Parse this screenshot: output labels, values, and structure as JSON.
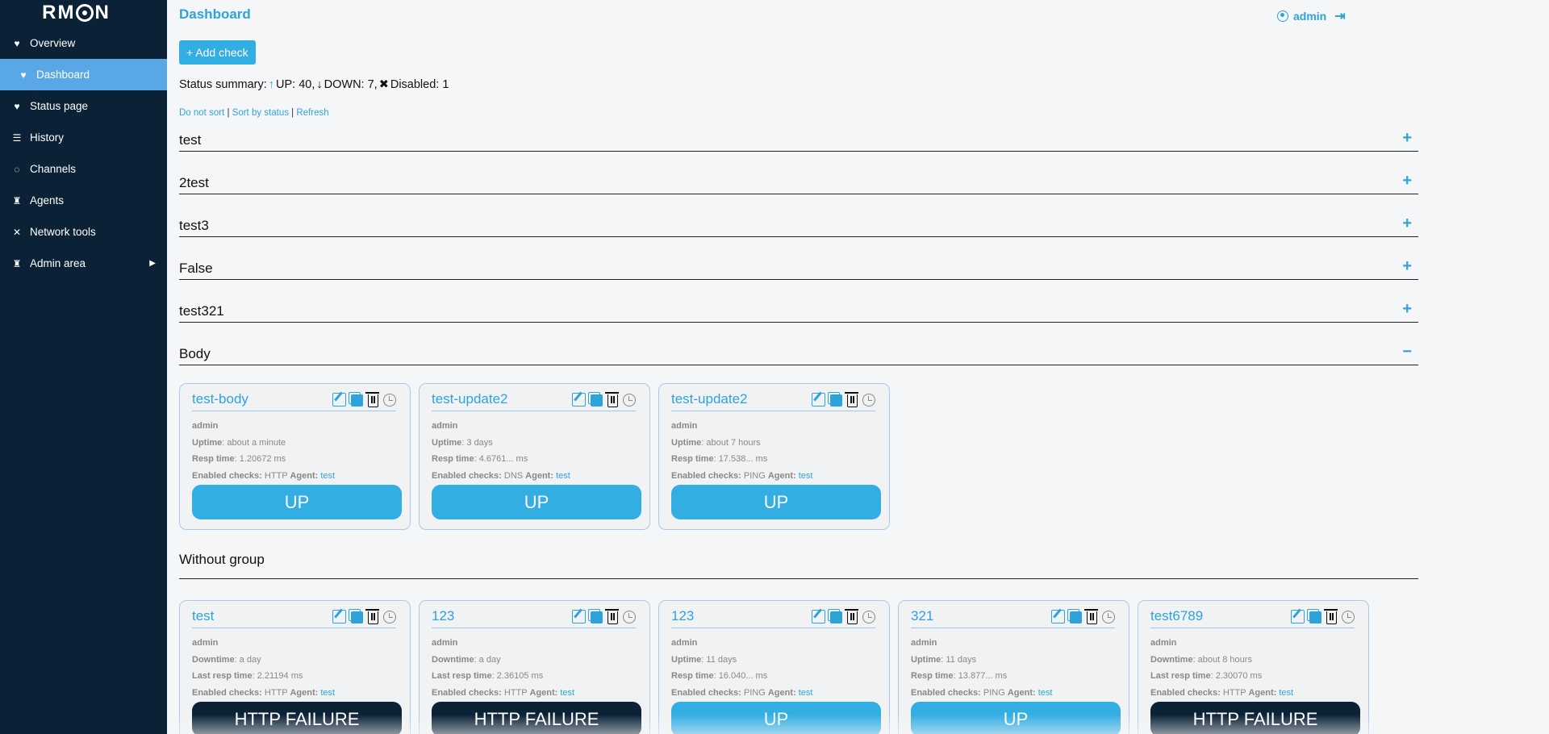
{
  "app": {
    "logo": "RMON",
    "logo_left": "RM",
    "logo_right": "N"
  },
  "sidebar": {
    "items": [
      {
        "label": "Overview",
        "icon": "heartbeat-icon"
      },
      {
        "label": "Dashboard",
        "icon": "heartbeat-icon",
        "active": true
      },
      {
        "label": "Status page",
        "icon": "heartbeat-icon"
      },
      {
        "label": "History",
        "icon": "list-icon"
      },
      {
        "label": "Channels",
        "icon": "chat-icon"
      },
      {
        "label": "Agents",
        "icon": "agent-icon"
      },
      {
        "label": "Network tools",
        "icon": "tools-icon"
      },
      {
        "label": "Admin area",
        "icon": "agent-icon",
        "has_submenu": true
      }
    ]
  },
  "header": {
    "title": "Dashboard",
    "user": "admin"
  },
  "toolbar": {
    "add_check_label": "+ Add check"
  },
  "summary": {
    "prefix": "Status summary:",
    "up_text": "UP: 40,",
    "down_text": "DOWN: 7,",
    "disabled_text": "Disabled: 1"
  },
  "sort": {
    "no_sort": "Do not sort",
    "sep": "|",
    "by_status": "Sort by status",
    "refresh": "Refresh"
  },
  "groups": [
    {
      "name": "test",
      "toggle": "+"
    },
    {
      "name": "2test",
      "toggle": "+"
    },
    {
      "name": "test3",
      "toggle": "+"
    },
    {
      "name": "False",
      "toggle": "+"
    },
    {
      "name": "test321",
      "toggle": "+"
    },
    {
      "name": "Body",
      "toggle": "−"
    }
  ],
  "body_cards": [
    {
      "name": "test-body",
      "owner": "admin",
      "l1k": "Uptime",
      "l1v": ": about a minute",
      "l2k": "Resp time",
      "l2v": ": 1.20672 ms",
      "l3k": "Enabled checks:",
      "l3v": " HTTP ",
      "agent_k": "Agent:",
      "agent": "test",
      "status": "UP"
    },
    {
      "name": "test-update2",
      "owner": "admin",
      "l1k": "Uptime",
      "l1v": ": 3 days",
      "l2k": "Resp time",
      "l2v": ": 4.6761... ms",
      "l3k": "Enabled checks:",
      "l3v": " DNS ",
      "agent_k": "Agent:",
      "agent": "test",
      "status": "UP"
    },
    {
      "name": "test-update2",
      "owner": "admin",
      "l1k": "Uptime",
      "l1v": ": about 7 hours",
      "l2k": "Resp time",
      "l2v": ": 17.538... ms",
      "l3k": "Enabled checks:",
      "l3v": " PING ",
      "agent_k": "Agent:",
      "agent": "test",
      "status": "UP"
    }
  ],
  "without_group": {
    "title": "Without group"
  },
  "ungrouped_cards": [
    {
      "name": "test",
      "owner": "admin",
      "l1k": "Downtime",
      "l1v": ": a day",
      "l2k": "Last resp time",
      "l2v": ": 2.21194 ms",
      "l3k": "Enabled checks:",
      "l3v": " HTTP ",
      "agent_k": "Agent:",
      "agent": "test",
      "status": "HTTP FAILURE"
    },
    {
      "name": "123",
      "owner": "admin",
      "l1k": "Downtime",
      "l1v": ": a day",
      "l2k": "Last resp time",
      "l2v": ": 2.36105 ms",
      "l3k": "Enabled checks:",
      "l3v": " HTTP ",
      "agent_k": "Agent:",
      "agent": "test",
      "status": "HTTP FAILURE"
    },
    {
      "name": "123",
      "owner": "admin",
      "l1k": "Uptime",
      "l1v": ": 11 days",
      "l2k": "Resp time",
      "l2v": ": 16.040... ms",
      "l3k": "Enabled checks:",
      "l3v": " PING ",
      "agent_k": "Agent:",
      "agent": "test",
      "status": "UP"
    },
    {
      "name": "321",
      "owner": "admin",
      "l1k": "Uptime",
      "l1v": ": 11 days",
      "l2k": "Resp time",
      "l2v": ": 13.877... ms",
      "l3k": "Enabled checks:",
      "l3v": " PING ",
      "agent_k": "Agent:",
      "agent": "test",
      "status": "UP"
    },
    {
      "name": "test6789",
      "owner": "admin",
      "l1k": "Downtime",
      "l1v": ": about 8 hours",
      "l2k": "Last resp time",
      "l2v": ": 2.30070 ms",
      "l3k": "Enabled checks:",
      "l3v": " HTTP ",
      "agent_k": "Agent:",
      "agent": "test",
      "status": "HTTP FAILURE"
    }
  ],
  "colors": {
    "accent": "#2ea3d9",
    "sidebar_bg": "#0b2236",
    "active_nav": "#5aa7e8",
    "failure": "#0b2236",
    "up": "#33aee2"
  }
}
